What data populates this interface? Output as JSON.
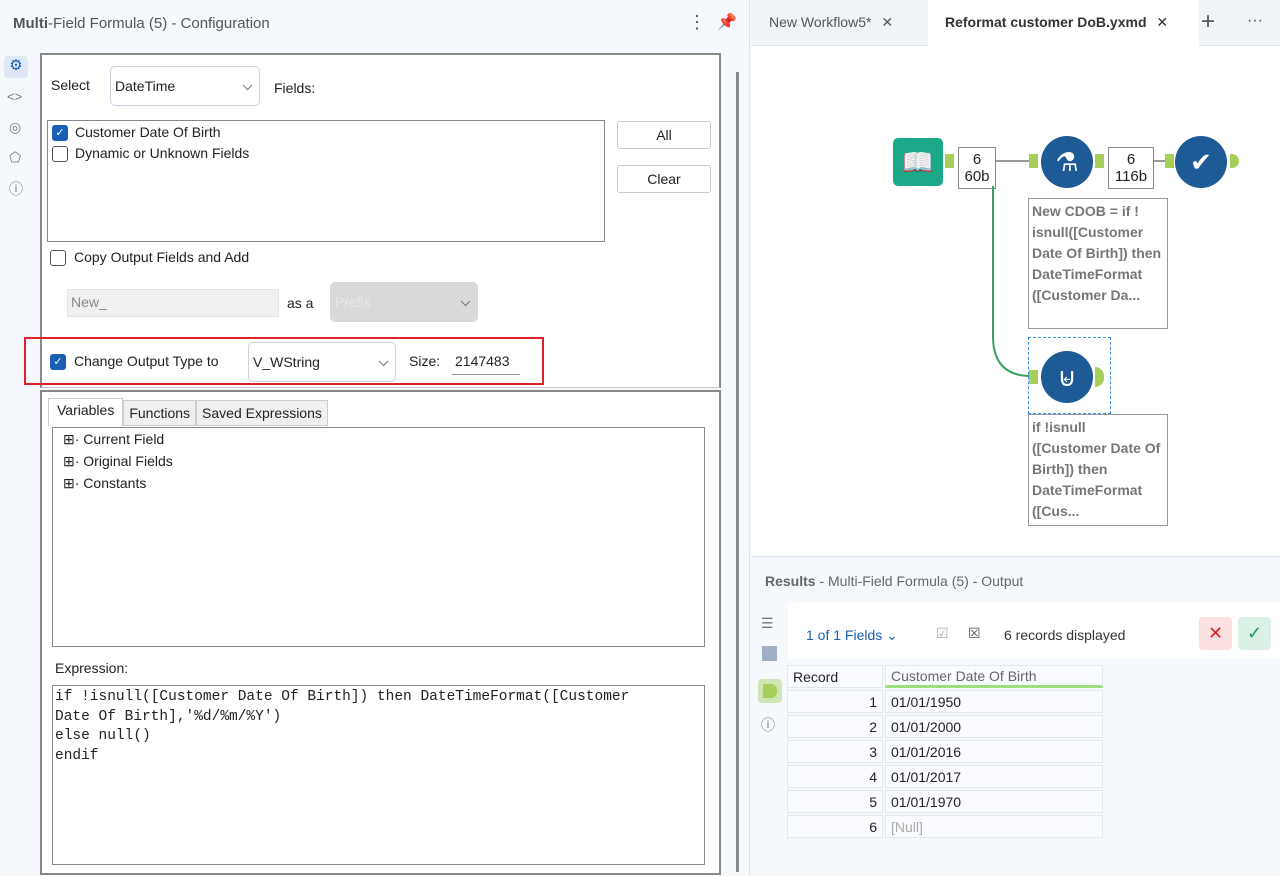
{
  "config": {
    "title_bold": "Multi",
    "title_rest": "-Field Formula (5) - Configuration",
    "select_label": "Select",
    "select_value": "DateTime",
    "fields_label": "Fields:",
    "fields": [
      {
        "label": "Customer Date Of Birth",
        "checked": true
      },
      {
        "label": "Dynamic or Unknown Fields",
        "checked": false
      }
    ],
    "all_button": "All",
    "clear_button": "Clear",
    "copy_output_label": "Copy Output Fields and Add",
    "copy_output_checked": false,
    "prefix_value": "New_",
    "as_a_label": "as a",
    "prefix_select": "Prefix",
    "change_type_label": "Change Output Type to",
    "change_type_checked": true,
    "type_value": "V_WString",
    "size_label": "Size:",
    "size_value": "2147483",
    "tabs": [
      "Variables",
      "Functions",
      "Saved Expressions"
    ],
    "tree": [
      "Current Field",
      "Original Fields",
      "Constants"
    ],
    "expression_label": "Expression:",
    "expression": "if !isnull([Customer Date Of Birth]) then DateTimeFormat([Customer\nDate Of Birth],'%d/%m/%Y')\nelse null()\nendif",
    "highlight_color": "#e0202a"
  },
  "tabs": [
    {
      "label": "New Workflow5*"
    },
    {
      "label": "Reformat customer DoB.yxmd",
      "active": true
    }
  ],
  "canvas": {
    "count1": [
      "6",
      "60b"
    ],
    "count2": [
      "6",
      "116b"
    ],
    "anno1": "New CDOB = if ! isnull([Customer Date Of Birth]) then DateTimeFormat ([Customer Da...",
    "anno2": "if !isnull ([Customer Date Of Birth]) then DateTimeFormat ([Cus..."
  },
  "results": {
    "title_bold": "Results",
    "title_rest": " - Multi-Field Formula (5) - Output",
    "fields_selector": "1 of 1 Fields",
    "records": "6 records displayed",
    "columns": [
      "Record",
      "Customer Date Of Birth"
    ],
    "rows": [
      [
        "1",
        "01/01/1950"
      ],
      [
        "2",
        "01/01/2000"
      ],
      [
        "3",
        "01/01/2016"
      ],
      [
        "4",
        "01/01/2017"
      ],
      [
        "5",
        "01/01/1970"
      ],
      [
        "6",
        "[Null]"
      ]
    ]
  }
}
